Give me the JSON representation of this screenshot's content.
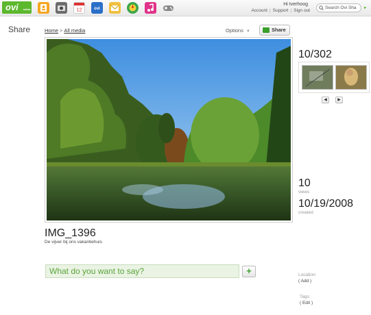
{
  "brand": {
    "logo_text": "ovi",
    "logo_small": "nokia"
  },
  "apps": [
    {
      "icon": "contacts-icon",
      "color": "#f5a623"
    },
    {
      "icon": "camera-icon",
      "color": "#6c6c6c"
    },
    {
      "icon": "calendar-icon",
      "color": "#d33",
      "text": "12"
    },
    {
      "icon": "ovi-store-icon",
      "color": "#2a6fc9",
      "text": "ovi"
    },
    {
      "icon": "mail-icon",
      "color": "#f0c040"
    },
    {
      "icon": "maps-icon",
      "color": "#3aa64a"
    },
    {
      "icon": "music-icon",
      "color": "#e0338a"
    },
    {
      "icon": "games-icon",
      "color": "#888"
    }
  ],
  "user": {
    "greeting": "Hi tverhoog",
    "links": [
      "Account",
      "Support",
      "Sign out"
    ]
  },
  "search": {
    "placeholder": "Search Ovi Sha"
  },
  "page": {
    "section_title": "Share"
  },
  "breadcrumb": {
    "home": "Home",
    "sep": ">",
    "current": "All media"
  },
  "toolbar": {
    "options_label": "Options",
    "share_label": "Share"
  },
  "media": {
    "position": "10/302",
    "title": "IMG_1396",
    "description": "De vijver bij ons vakantiehuis",
    "views": "10",
    "views_label": "views",
    "created_date": "10/19/2008",
    "created_label": "created"
  },
  "thumbnail_nav": {
    "prev": "◀",
    "next": "▶"
  },
  "comment": {
    "placeholder": "What do you want to say?",
    "add_label": "+"
  },
  "location": {
    "label": "Location:",
    "action": "( Add )"
  },
  "tags": {
    "label": "Tags:",
    "action": "( Edit )"
  },
  "colors": {
    "accent": "#5cb82d",
    "comment_bg": "#eaf3e4",
    "comment_text": "#5aa53a"
  }
}
